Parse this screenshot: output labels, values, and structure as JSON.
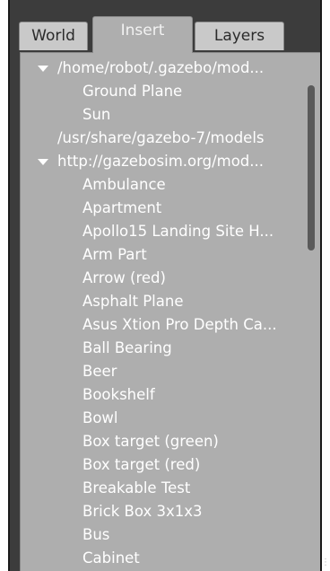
{
  "tabs": [
    {
      "label": "World",
      "active": false
    },
    {
      "label": "Insert",
      "active": true
    },
    {
      "label": "Layers",
      "active": false
    }
  ],
  "tree": {
    "groups": [
      {
        "path": "/home/robot/.gazebo/mod...",
        "expanded": true,
        "items": [
          "Ground Plane",
          "Sun"
        ]
      },
      {
        "path": "/usr/share/gazebo-7/models",
        "expanded": false,
        "items": []
      },
      {
        "path": "http://gazebosim.org/mod...",
        "expanded": true,
        "items": [
          "Ambulance",
          "Apartment",
          "Apollo15 Landing Site H...",
          "Arm Part",
          "Arrow (red)",
          "Asphalt Plane",
          "Asus Xtion Pro Depth Ca...",
          "Ball Bearing",
          "Beer",
          "Bookshelf",
          "Bowl",
          "Box target (green)",
          "Box target (red)",
          "Breakable Test",
          "Brick Box 3x1x3",
          "Bus",
          "Cabinet"
        ]
      }
    ]
  },
  "colors": {
    "panel_bg": "#aeaeae",
    "window_bg": "#3c3c3c",
    "text": "#ffffff",
    "scrollbar": "#5a5a5a"
  }
}
